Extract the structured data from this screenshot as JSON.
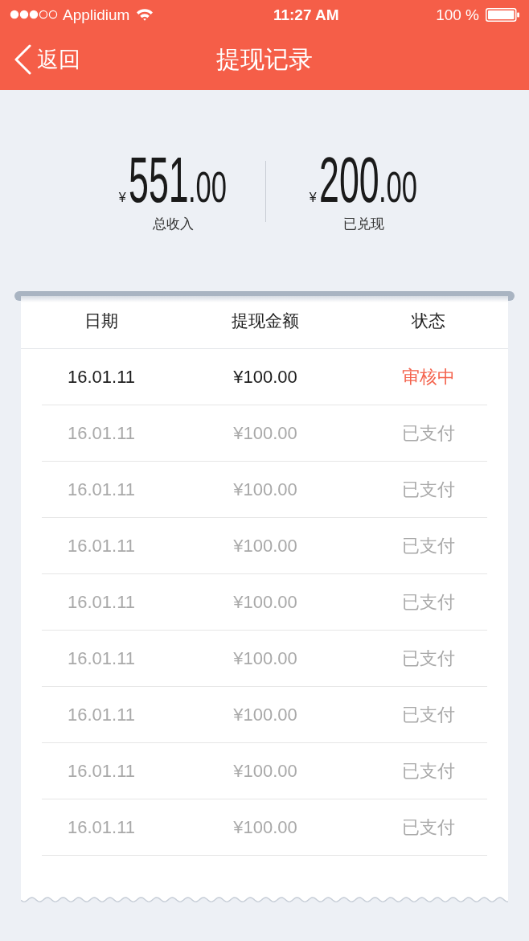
{
  "status_bar": {
    "carrier": "Applidium",
    "time": "11:27 AM",
    "battery": "100 %"
  },
  "nav": {
    "back": "返回",
    "title": "提现记录"
  },
  "summary": [
    {
      "amount": {
        "currency": "¥",
        "integer": "551",
        "decimal": ".00"
      },
      "label": "总收入"
    },
    {
      "amount": {
        "currency": "¥",
        "integer": "200",
        "decimal": ".00"
      },
      "label": "已兑现"
    }
  ],
  "table": {
    "columns": [
      "日期",
      "提现金额",
      "状态"
    ],
    "rows": [
      {
        "kind": "pending",
        "cells": [
          "16.01.11",
          "¥100.00",
          "审核中"
        ]
      },
      {
        "kind": "paid",
        "cells": [
          "16.01.11",
          "¥100.00",
          "已支付"
        ]
      },
      {
        "kind": "paid",
        "cells": [
          "16.01.11",
          "¥100.00",
          "已支付"
        ]
      },
      {
        "kind": "paid",
        "cells": [
          "16.01.11",
          "¥100.00",
          "已支付"
        ]
      },
      {
        "kind": "paid",
        "cells": [
          "16.01.11",
          "¥100.00",
          "已支付"
        ]
      },
      {
        "kind": "paid",
        "cells": [
          "16.01.11",
          "¥100.00",
          "已支付"
        ]
      },
      {
        "kind": "paid",
        "cells": [
          "16.01.11",
          "¥100.00",
          "已支付"
        ]
      },
      {
        "kind": "paid",
        "cells": [
          "16.01.11",
          "¥100.00",
          "已支付"
        ]
      },
      {
        "kind": "paid",
        "cells": [
          "16.01.11",
          "¥100.00",
          "已支付"
        ]
      }
    ]
  }
}
